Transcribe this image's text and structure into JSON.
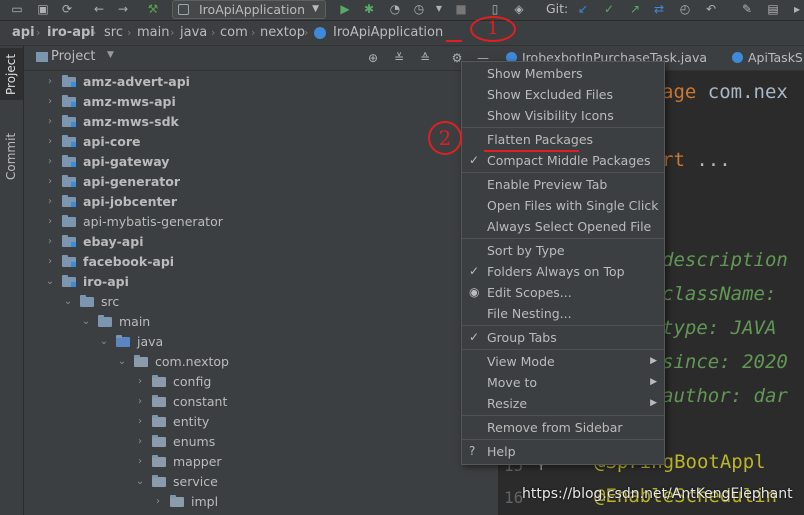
{
  "toolbar": {
    "run_config": "IroApiApplication",
    "git_label": "Git:"
  },
  "breadcrumb": [
    "api",
    "iro-api",
    "src",
    "main",
    "java",
    "com",
    "nextop",
    "IroApiApplication"
  ],
  "sidebar": {
    "project_tab": "Project",
    "commit_tab": "Commit"
  },
  "project_panel": {
    "title": "Project"
  },
  "tree": [
    {
      "label": "amz-advert-api",
      "level": 0,
      "bold": true,
      "expanded": false,
      "icon": "module-folder-icon"
    },
    {
      "label": "amz-mws-api",
      "level": 0,
      "bold": true,
      "expanded": false,
      "icon": "module-folder-icon"
    },
    {
      "label": "amz-mws-sdk",
      "level": 0,
      "bold": true,
      "expanded": false,
      "icon": "module-folder-icon"
    },
    {
      "label": "api-core",
      "level": 0,
      "bold": true,
      "expanded": false,
      "icon": "module-folder-icon"
    },
    {
      "label": "api-gateway",
      "level": 0,
      "bold": true,
      "expanded": false,
      "icon": "module-folder-icon"
    },
    {
      "label": "api-generator",
      "level": 0,
      "bold": true,
      "expanded": false,
      "icon": "module-folder-icon"
    },
    {
      "label": "api-jobcenter",
      "level": 0,
      "bold": true,
      "expanded": false,
      "icon": "module-folder-icon"
    },
    {
      "label": "api-mybatis-generator",
      "level": 0,
      "bold": false,
      "expanded": false,
      "icon": "folder-icon"
    },
    {
      "label": "ebay-api",
      "level": 0,
      "bold": true,
      "expanded": false,
      "icon": "module-folder-icon"
    },
    {
      "label": "facebook-api",
      "level": 0,
      "bold": true,
      "expanded": false,
      "icon": "module-folder-icon"
    },
    {
      "label": "iro-api",
      "level": 0,
      "bold": true,
      "expanded": true,
      "icon": "module-folder-icon"
    },
    {
      "label": "src",
      "level": 1,
      "bold": false,
      "expanded": true,
      "icon": "folder-icon"
    },
    {
      "label": "main",
      "level": 2,
      "bold": false,
      "expanded": true,
      "icon": "folder-icon"
    },
    {
      "label": "java",
      "level": 3,
      "bold": false,
      "expanded": true,
      "icon": "source-folder-icon"
    },
    {
      "label": "com.nextop",
      "level": 4,
      "bold": false,
      "expanded": true,
      "icon": "package-icon"
    },
    {
      "label": "config",
      "level": 5,
      "bold": false,
      "expanded": false,
      "icon": "package-icon"
    },
    {
      "label": "constant",
      "level": 5,
      "bold": false,
      "expanded": false,
      "icon": "package-icon"
    },
    {
      "label": "entity",
      "level": 5,
      "bold": false,
      "expanded": false,
      "icon": "package-icon"
    },
    {
      "label": "enums",
      "level": 5,
      "bold": false,
      "expanded": false,
      "icon": "package-icon"
    },
    {
      "label": "mapper",
      "level": 5,
      "bold": false,
      "expanded": false,
      "icon": "package-icon"
    },
    {
      "label": "service",
      "level": 5,
      "bold": false,
      "expanded": true,
      "icon": "package-icon"
    },
    {
      "label": "impl",
      "level": 6,
      "bold": false,
      "expanded": false,
      "icon": "package-icon"
    }
  ],
  "editor": {
    "tabs": [
      "IrobexbotInPurchaseTask.java",
      "ApiTaskS"
    ],
    "code_lines": [
      {
        "text": "age com.nex",
        "color": "#a9b7c6",
        "kw": "age",
        "kwcolor": "#cc7832"
      },
      {
        "text": "rt ...",
        "color": "#a9b7c6",
        "kw": "rt",
        "kwcolor": "#cc7832"
      },
      {
        "text": "description",
        "color": "#629755",
        "italic": true
      },
      {
        "text": "className:",
        "color": "#629755",
        "italic": true
      },
      {
        "text": "type: JAVA",
        "color": "#629755",
        "italic": true
      },
      {
        "text": "since: 2020",
        "color": "#629755",
        "italic": true
      },
      {
        "text": "author: dar",
        "color": "#629755",
        "italic": true
      },
      {
        "text": "@SpringBootAppl",
        "color": "#bbb529"
      },
      {
        "text": "@EnableSchedulin",
        "color": "#bbb529"
      }
    ],
    "line_numbers": [
      "15",
      "16"
    ]
  },
  "menu": {
    "items": [
      {
        "label": "Show Members",
        "check": "",
        "sub": false
      },
      {
        "label": "Show Excluded Files",
        "check": "",
        "sub": false
      },
      {
        "label": "Show Visibility Icons",
        "check": "",
        "sub": false
      },
      {
        "label": "Flatten Packages",
        "check": "",
        "sub": false
      },
      {
        "label": "Compact Middle Packages",
        "check": "✓",
        "sub": false
      },
      {
        "label": "Enable Preview Tab",
        "check": "",
        "sub": false
      },
      {
        "label": "Open Files with Single Click",
        "check": "",
        "sub": false
      },
      {
        "label": "Always Select Opened File",
        "check": "",
        "sub": false
      },
      {
        "label": "Sort by Type",
        "check": "",
        "sub": false
      },
      {
        "label": "Folders Always on Top",
        "check": "✓",
        "sub": false
      },
      {
        "label": "Edit Scopes...",
        "check": "◉",
        "sub": false
      },
      {
        "label": "File Nesting...",
        "check": "",
        "sub": false
      },
      {
        "label": "Group Tabs",
        "check": "✓",
        "sub": false
      },
      {
        "label": "View Mode",
        "check": "",
        "sub": true
      },
      {
        "label": "Move to",
        "check": "",
        "sub": true
      },
      {
        "label": "Resize",
        "check": "",
        "sub": true
      },
      {
        "label": "Remove from Sidebar",
        "check": "",
        "sub": false
      },
      {
        "label": "Help",
        "check": "?",
        "sub": false
      }
    ]
  },
  "annotations": {
    "mark1": "1",
    "mark2": "2",
    "color": "#e02020"
  },
  "watermark": "https://blog.csdn.net/AntKengElephant"
}
